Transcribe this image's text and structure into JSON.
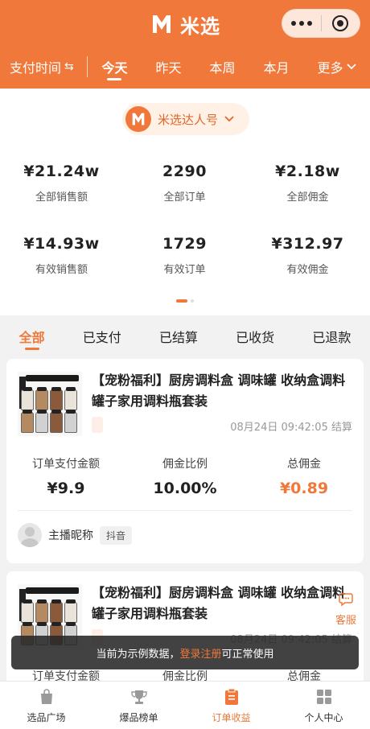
{
  "header": {
    "brand_name": "米选",
    "accent_color": "#f0783a"
  },
  "filter_bar": {
    "sort_label": "支付时间",
    "sort_icon": "swap-arrows-icon",
    "periods": [
      "今天",
      "昨天",
      "本周",
      "本月"
    ],
    "active_period": "今天",
    "more_label": "更多"
  },
  "account_selector": {
    "name": "米选达人号"
  },
  "stats": [
    {
      "value": "¥21.24w",
      "label": "全部销售额"
    },
    {
      "value": "2290",
      "label": "全部订单"
    },
    {
      "value": "¥2.18w",
      "label": "全部佣金"
    },
    {
      "value": "¥14.93w",
      "label": "有效销售额"
    },
    {
      "value": "1729",
      "label": "有效订单"
    },
    {
      "value": "¥312.97",
      "label": "有效佣金"
    }
  ],
  "status_tabs": {
    "items": [
      "全部",
      "已支付",
      "已结算",
      "已收货",
      "已退款"
    ],
    "active": "全部"
  },
  "orders": [
    {
      "title": "【宠粉福利】厨房调料盒 调味罐 收纳盒调料罐子家用调料瓶套装",
      "time_status": "08月24日 09:42:05 结算",
      "pay_amount_label": "订单支付金额",
      "pay_amount": "¥9.9",
      "ratio_label": "佣金比例",
      "ratio": "10.00%",
      "commission_label": "总佣金",
      "commission": "¥0.89",
      "host_name": "主播昵称",
      "platform": "抖音"
    },
    {
      "title": "【宠粉福利】厨房调料盒 调味罐 收纳盒调料罐子家用调料瓶套装",
      "time_status": "08月24日 09:42:05 结算",
      "pay_amount_label": "订单支付金额",
      "ratio_label": "佣金比例",
      "commission_label": "总佣金"
    }
  ],
  "service": {
    "label": "客服"
  },
  "toast": {
    "prefix": "当前为示例数据，",
    "link": "登录注册",
    "suffix": "可正常使用"
  },
  "bottom_nav": [
    {
      "label": "选品广场",
      "icon": "shopping-bag-icon"
    },
    {
      "label": "爆品榜单",
      "icon": "trophy-icon"
    },
    {
      "label": "订单收益",
      "icon": "clipboard-icon",
      "active": true
    },
    {
      "label": "个人中心",
      "icon": "grid-icon"
    }
  ]
}
